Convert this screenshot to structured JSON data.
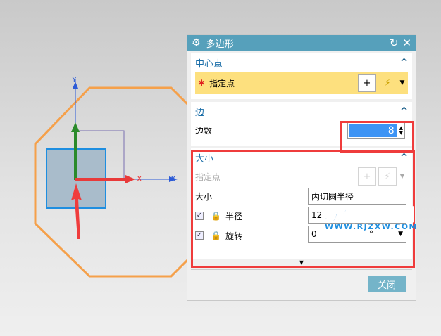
{
  "canvas": {
    "axis_x": "X",
    "axis_y": "Y",
    "colors": {
      "octagon": "#f5a04a",
      "square": "#a9bccb",
      "axis": "#2d5bd6",
      "red": "#e83a3a",
      "green": "#2a8a2a"
    }
  },
  "dialog": {
    "title": "多边形",
    "center_group": {
      "title": "中心点",
      "specify_point": "指定点"
    },
    "edge_group": {
      "title": "边",
      "count_label": "边数",
      "count_value": "8"
    },
    "size_group": {
      "title": "大小",
      "specify_point": "指定点",
      "size_label": "大小",
      "size_value": "内切圆半径",
      "radius_label": "半径",
      "radius_value": "12",
      "rotation_label": "旋转",
      "rotation_value": "0",
      "rotation_unit": "°"
    },
    "close_label": "关闭"
  },
  "watermark": {
    "text": "软件自学网",
    "url": "WWW.RJZXW.COM"
  }
}
